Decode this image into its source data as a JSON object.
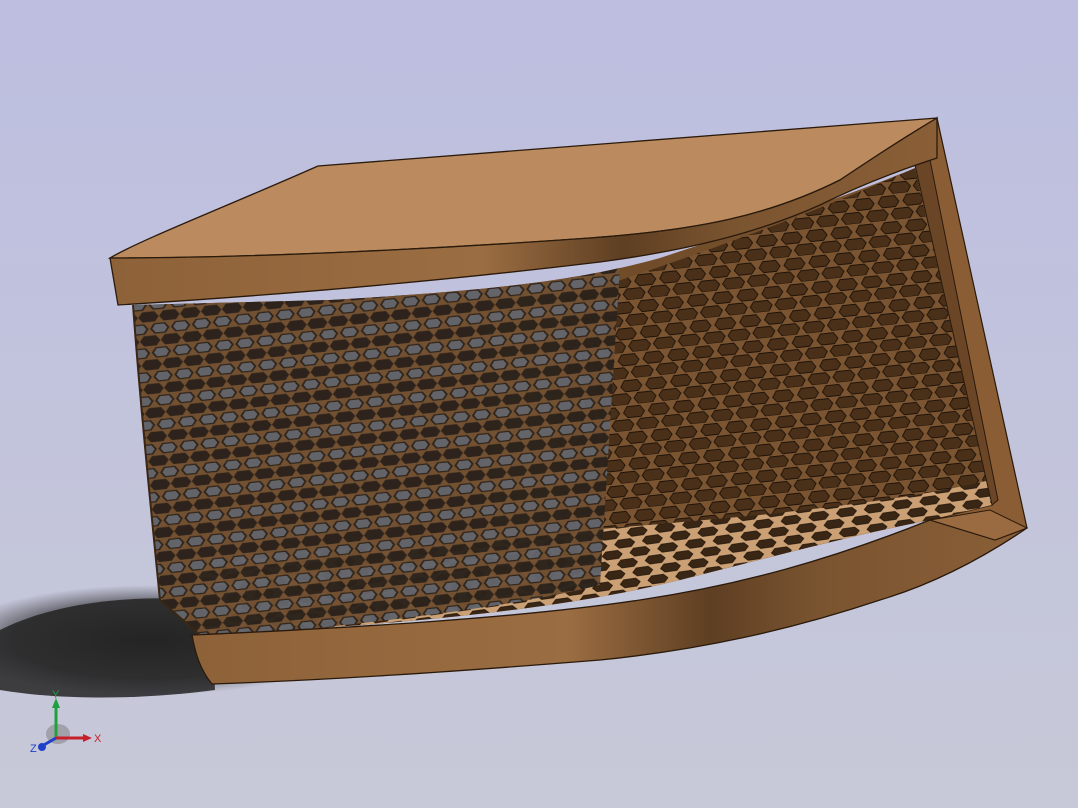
{
  "viewport": {
    "background_top": "#bdbee0",
    "background_bottom": "#c7c9d8"
  },
  "model": {
    "body_color": "#b98a5e",
    "edge_color": "#2a1a0c",
    "mesh_pattern": "hexagonal"
  },
  "triad": {
    "x_label": "X",
    "y_label": "Y",
    "z_label": "Z",
    "x_color": "#c8202a",
    "y_color": "#20a040",
    "z_color": "#2040c8"
  }
}
